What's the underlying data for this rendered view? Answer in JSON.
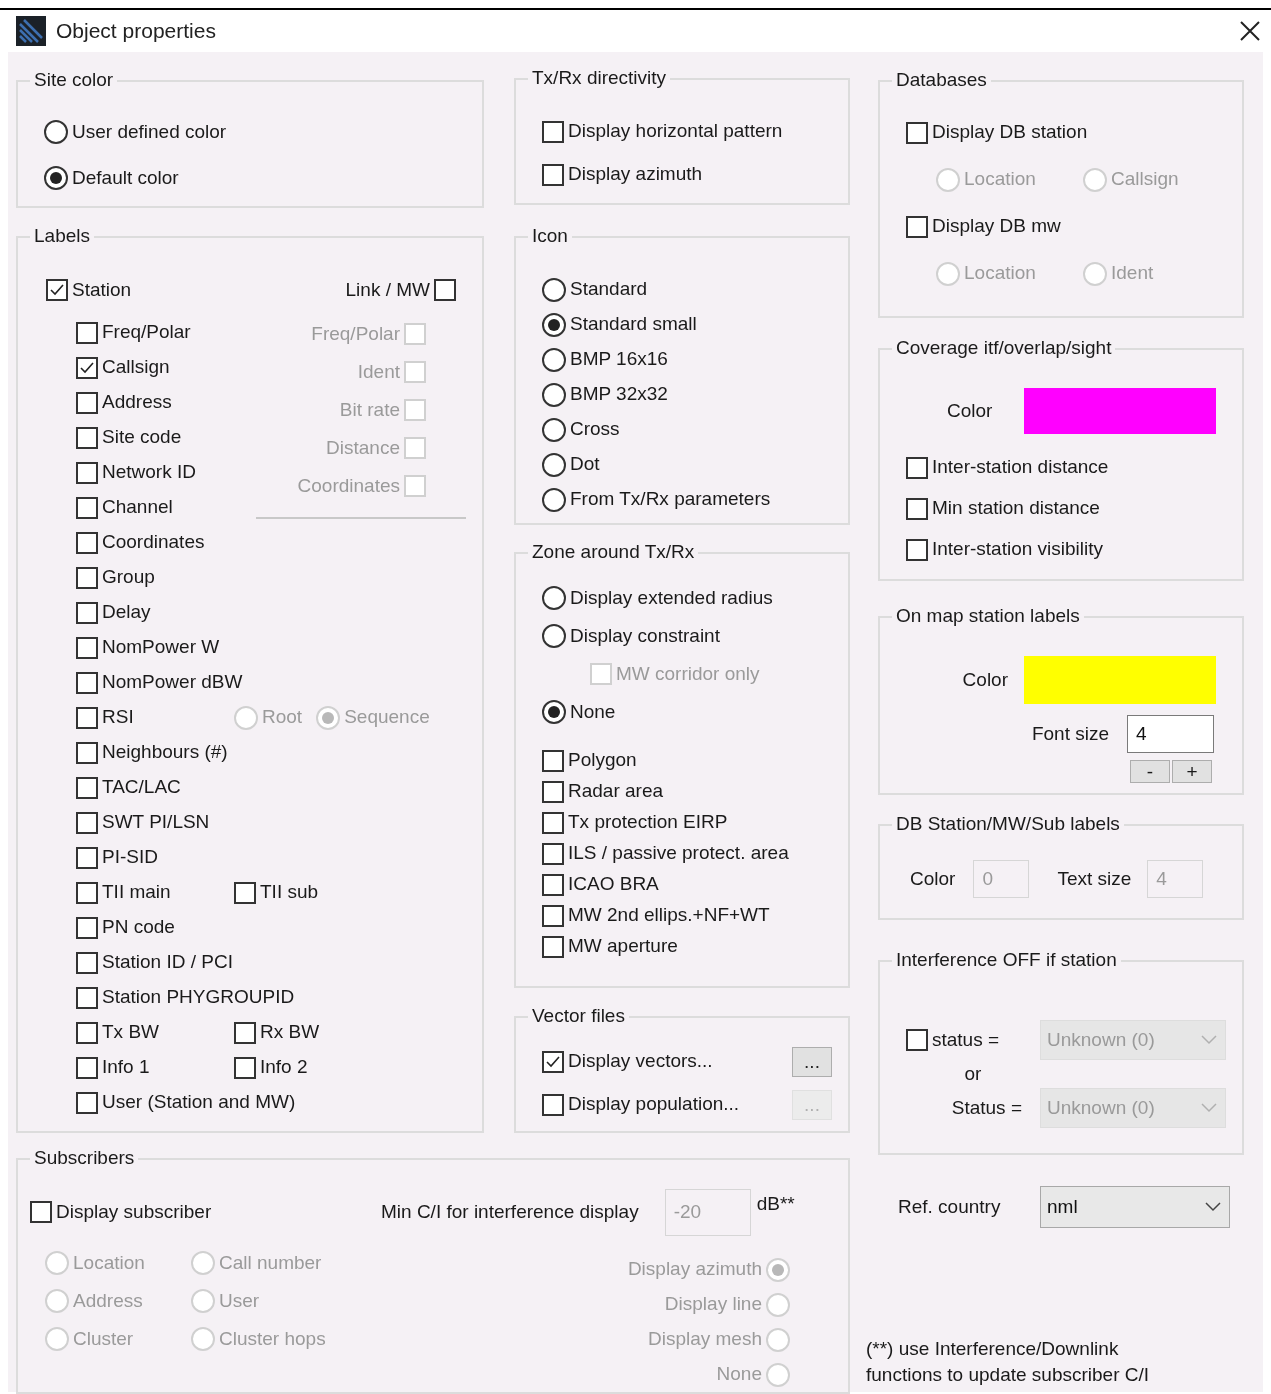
{
  "window": {
    "title": "Object properties"
  },
  "site_color": {
    "title": "Site color",
    "options": [
      {
        "label": "User defined color",
        "selected": false
      },
      {
        "label": "Default color",
        "selected": true
      }
    ]
  },
  "labels": {
    "title": "Labels",
    "station": {
      "label": "Station",
      "checked": true
    },
    "link_mw": {
      "label": "Link / MW",
      "checked": false
    },
    "fields": [
      {
        "label": "Freq/Polar",
        "checked": false
      },
      {
        "label": "Callsign",
        "checked": true
      },
      {
        "label": "Address",
        "checked": false
      },
      {
        "label": "Site code",
        "checked": false
      },
      {
        "label": "Network ID",
        "checked": false
      },
      {
        "label": "Channel",
        "checked": false
      },
      {
        "label": "Coordinates",
        "checked": false
      }
    ],
    "mw_fields": {
      "disabled": true,
      "items": [
        {
          "label": "Freq/Polar",
          "checked": false
        },
        {
          "label": "Ident",
          "checked": false
        },
        {
          "label": "Bit rate",
          "checked": false
        },
        {
          "label": "Distance",
          "checked": false
        },
        {
          "label": "Coordinates",
          "checked": false
        }
      ]
    },
    "more_fields": [
      {
        "label": "Group",
        "checked": false
      },
      {
        "label": "Delay",
        "checked": false
      },
      {
        "label": "NomPower W",
        "checked": false
      },
      {
        "label": "NomPower dBW",
        "checked": false
      },
      {
        "label": "RSI",
        "checked": false,
        "options": {
          "disabled": true,
          "items": [
            {
              "label": "Root",
              "selected": false
            },
            {
              "label": "Sequence",
              "selected": true
            }
          ]
        }
      },
      {
        "label": "Neighbours (#)",
        "checked": false
      },
      {
        "label": "TAC/LAC",
        "checked": false
      },
      {
        "label": "SWT PI/LSN",
        "checked": false
      },
      {
        "label": "PI-SID",
        "checked": false
      },
      {
        "label": "TII main",
        "checked": false,
        "pair": {
          "label": "TII sub",
          "checked": false
        }
      },
      {
        "label": "PN code",
        "checked": false
      },
      {
        "label": "Station ID / PCI",
        "checked": false
      },
      {
        "label": "Station PHYGROUPID",
        "checked": false
      },
      {
        "label": "Tx BW",
        "checked": false,
        "pair": {
          "label": "Rx BW",
          "checked": false
        }
      },
      {
        "label": "Info 1",
        "checked": false,
        "pair": {
          "label": "Info 2",
          "checked": false
        }
      },
      {
        "label": "User (Station and MW)",
        "checked": false
      }
    ]
  },
  "directivity": {
    "title": "Tx/Rx directivity",
    "items": [
      {
        "label": "Display horizontal pattern",
        "checked": false
      },
      {
        "label": "Display azimuth",
        "checked": false
      }
    ]
  },
  "icon": {
    "title": "Icon",
    "options": [
      {
        "label": "Standard",
        "selected": false
      },
      {
        "label": "Standard small",
        "selected": true
      },
      {
        "label": "BMP 16x16",
        "selected": false
      },
      {
        "label": "BMP 32x32",
        "selected": false
      },
      {
        "label": "Cross",
        "selected": false
      },
      {
        "label": "Dot",
        "selected": false
      },
      {
        "label": "From Tx/Rx parameters",
        "selected": false
      }
    ]
  },
  "zone": {
    "title": "Zone around Tx/Rx",
    "items": [
      {
        "kind": "radio",
        "label": "Display extended radius",
        "selected": false,
        "disabled": false
      },
      {
        "kind": "radio",
        "label": "Display constraint",
        "selected": false,
        "disabled": false
      },
      {
        "kind": "checkbox",
        "label": "MW corridor only",
        "checked": false,
        "disabled": true
      },
      {
        "kind": "radio",
        "label": "None",
        "selected": true,
        "disabled": false
      },
      {
        "kind": "checkbox",
        "label": "Polygon",
        "checked": false,
        "disabled": false
      },
      {
        "kind": "checkbox",
        "label": "Radar area",
        "checked": false,
        "disabled": false
      },
      {
        "kind": "checkbox",
        "label": "Tx protection EIRP",
        "checked": false,
        "disabled": false
      },
      {
        "kind": "checkbox",
        "label": "ILS / passive protect. area",
        "checked": false,
        "disabled": false
      },
      {
        "kind": "checkbox",
        "label": "ICAO BRA",
        "checked": false,
        "disabled": false
      },
      {
        "kind": "checkbox",
        "label": "MW 2nd ellips.+NF+WT",
        "checked": false,
        "disabled": false
      },
      {
        "kind": "checkbox",
        "label": "MW aperture",
        "checked": false,
        "disabled": false
      }
    ]
  },
  "vector_files": {
    "title": "Vector files",
    "items": [
      {
        "label": "Display vectors...",
        "checked": true,
        "button": {
          "label": "...",
          "disabled": false
        }
      },
      {
        "label": "Display population...",
        "checked": false,
        "button": {
          "label": "...",
          "disabled": true
        }
      }
    ]
  },
  "databases": {
    "title": "Databases",
    "items": [
      {
        "label": "Display DB station",
        "checked": false,
        "options": {
          "disabled": true,
          "items": [
            {
              "label": "Location",
              "selected": false
            },
            {
              "label": "Callsign",
              "selected": false
            }
          ]
        }
      },
      {
        "label": "Display DB mw",
        "checked": false,
        "options": {
          "disabled": true,
          "items": [
            {
              "label": "Location",
              "selected": false
            },
            {
              "label": "Ident",
              "selected": false
            }
          ]
        }
      }
    ]
  },
  "coverage": {
    "title": "Coverage itf/overlap/sight",
    "color": {
      "label": "Color",
      "color": "#ff00ff"
    },
    "items": [
      {
        "label": "Inter-station distance",
        "checked": false
      },
      {
        "label": "Min station distance",
        "checked": false
      },
      {
        "label": "Inter-station visibility",
        "checked": false
      }
    ]
  },
  "map_labels": {
    "title": "On map station labels",
    "color": {
      "label": "Color",
      "color": "#ffff00"
    },
    "font_size": {
      "label": "Font size",
      "value": "4"
    },
    "stepper": [
      "-",
      "+"
    ]
  },
  "db_labels": {
    "title": "DB Station/MW/Sub labels",
    "fields": [
      {
        "label": "Color",
        "value": "0",
        "disabled": true
      },
      {
        "label": "Text size",
        "value": "4",
        "disabled": true
      }
    ]
  },
  "interference": {
    "title": "Interference OFF if station",
    "status_check": {
      "label": "status =",
      "checked": false
    },
    "status_select": {
      "value": "Unknown (0)",
      "disabled": true
    },
    "joiner": "or",
    "second_label": "Status =",
    "second_select": {
      "value": "Unknown (0)",
      "disabled": true
    }
  },
  "ref_country": {
    "label": "Ref. country",
    "value": "nml"
  },
  "footnote": "(**) use Interference/Downlink functions to update subscriber C/I",
  "subscribers": {
    "title": "Subscribers",
    "display": {
      "label": "Display subscriber",
      "checked": false
    },
    "min_ci": {
      "label": "Min C/I for interference display",
      "value": "-20",
      "unit": "dB**",
      "disabled": true
    },
    "display_options": {
      "disabled": true,
      "items": [
        {
          "label": "Location",
          "selected": false
        },
        {
          "label": "Call number",
          "selected": false
        },
        {
          "label": "Address",
          "selected": false
        },
        {
          "label": "User",
          "selected": false
        },
        {
          "label": "Cluster",
          "selected": false
        },
        {
          "label": "Cluster hops",
          "selected": false
        }
      ]
    },
    "line_options": {
      "disabled": true,
      "items": [
        {
          "label": "Display azimuth",
          "selected": true
        },
        {
          "label": "Display line",
          "selected": false
        },
        {
          "label": "Display mesh",
          "selected": false
        },
        {
          "label": "None",
          "selected": false
        }
      ]
    }
  }
}
